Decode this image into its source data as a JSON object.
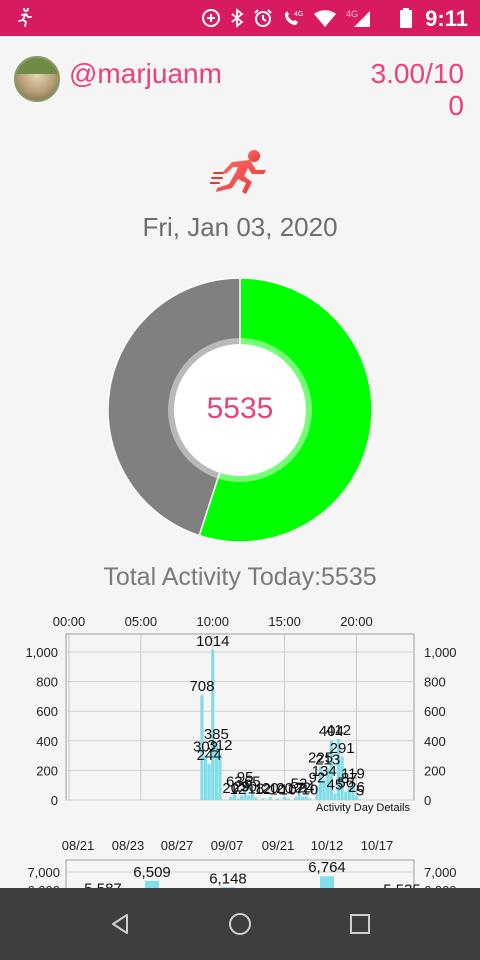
{
  "status_bar": {
    "time": "9:11",
    "network_label": "4G",
    "icons": [
      "runner-icon",
      "data-saver-icon",
      "bluetooth-icon",
      "alarm-icon",
      "volte-icon",
      "wifi-icon",
      "signal-icon",
      "battery-icon"
    ]
  },
  "header": {
    "username": "@marjuanm",
    "goal_text": "3.00/100"
  },
  "day": {
    "date": "Fri, Jan 03, 2020",
    "center_value": "5535",
    "total_label": "Total Activity Today:5535"
  },
  "colors": {
    "accent": "#ec407a",
    "status_bar": "#d81b60",
    "donut_done": "#00ff00",
    "donut_remaining": "#808080",
    "bar": "#80deea"
  },
  "chart_data": [
    {
      "type": "pie",
      "values": [
        0.55,
        0.45
      ],
      "colors": [
        "#00ff00",
        "#808080"
      ]
    },
    {
      "type": "bar",
      "top_axis_ticks": [
        "00:00",
        "05:00",
        "10:00",
        "15:00",
        "20:00"
      ],
      "top_axis_hours": [
        0,
        5,
        10,
        15,
        20
      ],
      "yticks": [
        "0",
        "200",
        "400",
        "600",
        "800",
        "1,000"
      ],
      "ylim": [
        0,
        1000
      ],
      "annotation": "Activity Day Details",
      "bars": [
        {
          "hour": 9.25,
          "value": 708,
          "label": "708"
        },
        {
          "hour": 9.5,
          "value": 302,
          "label": "302"
        },
        {
          "hour": 9.75,
          "value": 244,
          "label": "244"
        },
        {
          "hour": 10.0,
          "value": 1014,
          "label": "1014"
        },
        {
          "hour": 10.25,
          "value": 385,
          "label": "385"
        },
        {
          "hour": 10.5,
          "value": 312,
          "label": "312"
        },
        {
          "hour": 11.25,
          "value": 20,
          "label": "20"
        },
        {
          "hour": 11.5,
          "value": 63,
          "label": "63"
        },
        {
          "hour": 11.75,
          "value": 12,
          "label": "12"
        },
        {
          "hour": 12.0,
          "value": 29,
          "label": "29"
        },
        {
          "hour": 12.25,
          "value": 95,
          "label": "95"
        },
        {
          "hour": 12.5,
          "value": 30,
          "label": "30"
        },
        {
          "hour": 12.75,
          "value": 65,
          "label": "65"
        },
        {
          "hour": 13.0,
          "value": 18,
          "label": "18"
        },
        {
          "hour": 13.5,
          "value": 12,
          "label": "12"
        },
        {
          "hour": 14.0,
          "value": 20,
          "label": "20"
        },
        {
          "hour": 14.5,
          "value": 10,
          "label": "10"
        },
        {
          "hour": 15.0,
          "value": 20,
          "label": "20"
        },
        {
          "hour": 15.25,
          "value": 10,
          "label": "10"
        },
        {
          "hour": 15.75,
          "value": 17,
          "label": "17"
        },
        {
          "hour": 16.0,
          "value": 52,
          "label": "52"
        },
        {
          "hour": 16.25,
          "value": 22,
          "label": "22"
        },
        {
          "hour": 16.5,
          "value": 24,
          "label": "24"
        },
        {
          "hour": 16.75,
          "value": 10,
          "label": "10"
        },
        {
          "hour": 17.25,
          "value": 92,
          "label": "92"
        },
        {
          "hour": 17.5,
          "value": 225,
          "label": "225"
        },
        {
          "hour": 17.75,
          "value": 134,
          "label": "134"
        },
        {
          "hour": 18.0,
          "value": 213,
          "label": "213"
        },
        {
          "hour": 18.25,
          "value": 404,
          "label": "404"
        },
        {
          "hour": 18.5,
          "value": 45,
          "label": "45"
        },
        {
          "hour": 18.75,
          "value": 412,
          "label": "412"
        },
        {
          "hour": 19.0,
          "value": 291,
          "label": "291"
        },
        {
          "hour": 19.25,
          "value": 56,
          "label": "56"
        },
        {
          "hour": 19.5,
          "value": 87,
          "label": "87"
        },
        {
          "hour": 19.75,
          "value": 119,
          "label": "119"
        },
        {
          "hour": 20.0,
          "value": 26,
          "label": "26"
        },
        {
          "hour": 20.25,
          "value": 5,
          "label": "5"
        }
      ]
    },
    {
      "type": "bar",
      "top_axis_ticks": [
        "08/21",
        "08/23",
        "08/27",
        "09/07",
        "09/21",
        "10/12",
        "10/17"
      ],
      "yticks": [
        "7,000",
        "6,000"
      ],
      "bars": [
        {
          "date": "08/21",
          "value": 5587,
          "label": "5,587"
        },
        {
          "date": "08/27",
          "value": 6509,
          "label": "6,509"
        },
        {
          "date": "09/07",
          "value": 6148,
          "label": "6,148"
        },
        {
          "date": "10/12",
          "value": 6764,
          "label": "6,764"
        },
        {
          "date": "10/17",
          "value": 5535,
          "label": "5,535"
        }
      ]
    }
  ],
  "navigation": {
    "buttons": [
      "back",
      "home",
      "recents"
    ]
  }
}
